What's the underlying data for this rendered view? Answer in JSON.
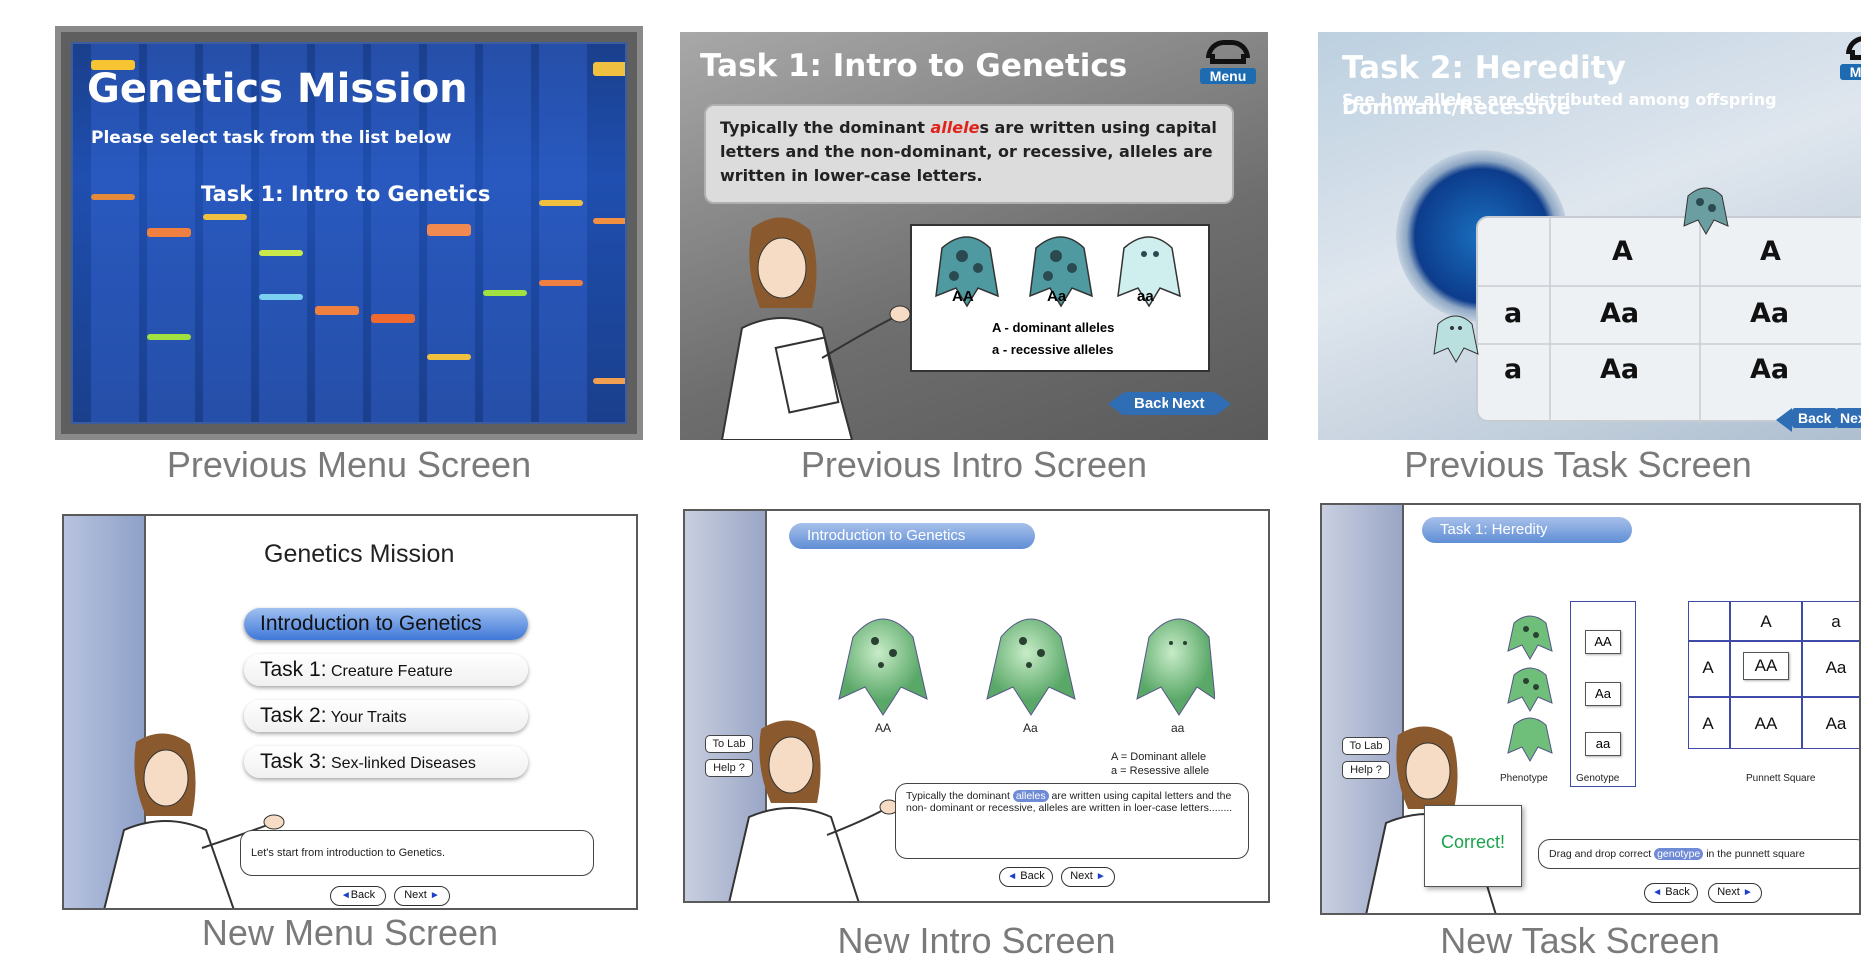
{
  "captions": {
    "prev_menu": "Previous Menu Screen",
    "prev_intro": "Previous Intro Screen",
    "prev_task": "Previous Task Screen",
    "new_menu": "New Menu Screen",
    "new_intro": "New Intro Screen",
    "new_task": "New Task Screen"
  },
  "prev_menu": {
    "title": "Genetics Mission",
    "subtitle": "Please select task from the list below",
    "task": "Task 1: Intro to Genetics"
  },
  "prev_intro": {
    "title": "Task 1: Intro to Genetics",
    "menu_label": "Menu",
    "text_before": "Typically the dominant ",
    "text_highlight": "allele",
    "text_after": "s are written using capital letters and the non-dominant, or recessive, alleles are written in lower-case letters.",
    "creature_labels": [
      "AA",
      "Aa",
      "aa"
    ],
    "legend_1": "A - dominant alleles",
    "legend_2": "a - recessive alleles",
    "back": "Back",
    "next": "Next"
  },
  "prev_task": {
    "title": "Task 2: Heredity",
    "title_suffix": "Dominant/Recessive",
    "subtitle": "See how alleles are distributed among offspring",
    "menu_label": "Menu",
    "col_headers": [
      "A",
      "A"
    ],
    "row_headers": [
      "a",
      "a"
    ],
    "cells": [
      "Aa",
      "Aa",
      "Aa",
      "Aa"
    ],
    "back": "Back",
    "next": "Next"
  },
  "new_menu": {
    "title": "Genetics Mission",
    "items": [
      {
        "main": "Introduction to Genetics",
        "sub": ""
      },
      {
        "main": "Task 1:",
        "sub": " Creature Feature"
      },
      {
        "main": "Task 2:",
        "sub": " Your Traits"
      },
      {
        "main": "Task 3:",
        "sub": " Sex-linked Diseases"
      }
    ],
    "speech": "Let's start from introduction to Genetics.",
    "back": "Back",
    "next": "Next"
  },
  "new_intro": {
    "header": "Introduction to Genetics",
    "to_lab": "To Lab",
    "help": "Help ?",
    "creature_labels": [
      "AA",
      "Aa",
      "aa"
    ],
    "legend_1": "A = Dominant allele",
    "legend_2": "a = Resessive allele",
    "speech_before": "Typically the dominant ",
    "speech_highlight": "alleles",
    "speech_after": " are written using capital letters and the non- dominant or recessive, alleles are written in loer-case letters........",
    "back": "Back",
    "next": "Next"
  },
  "new_task": {
    "header": "Task 1: Heredity",
    "to_lab": "To Lab",
    "help": "Help ?",
    "genotypes": [
      "AA",
      "Aa",
      "aa"
    ],
    "phenotype_label": "Phenotype",
    "genotype_label": "Genotype",
    "punnett_label": "Punnett Square",
    "col_headers": [
      "A",
      "a"
    ],
    "row_headers": [
      "A",
      "A"
    ],
    "cells": [
      "AA",
      "Aa",
      "AA",
      "Aa"
    ],
    "correct": "Correct!",
    "instruction_before": "Drag and drop correct ",
    "instruction_highlight": "genotype",
    "instruction_after": " in the punnett square",
    "back": "Back",
    "next": "Next"
  },
  "colors": {
    "accent_blue": "#3f78d8",
    "green_creature": "#6fbf7a",
    "correct_green": "#19a34a",
    "gel_blue": "#1f4fb0"
  }
}
